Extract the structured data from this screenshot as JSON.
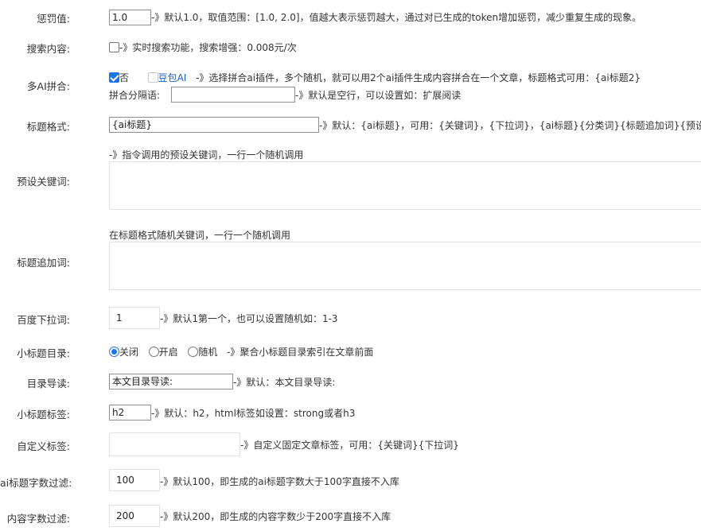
{
  "penalty": {
    "label": "惩罚值:",
    "value": "1.0",
    "hint": "-》默认1.0，取值范围：[1.0, 2.0]，值越大表示惩罚越大，通过对已生成的token增加惩罚，减少重复生成的现象。"
  },
  "search": {
    "label": "搜索内容:",
    "checked": false,
    "hint": "-》实时搜索功能，搜索增强：0.008元/次"
  },
  "multi_ai": {
    "label": "多AI拼合:",
    "option_no": "否",
    "option_no_checked": true,
    "option_doubao": "豆包AI",
    "option_doubao_checked": false,
    "hint": "-》选择拼合ai插件，多个随机，就可以用2个ai插件生成内容拼合在一个文章，标题格式可用：{ai标题2}",
    "separator_label": "拼合分隔语:",
    "separator_value": "",
    "separator_hint": "-》默认是空行，可以设置如：扩展阅读"
  },
  "title_format": {
    "label": "标题格式:",
    "value": "{ai标题}",
    "hint": "-》默认：{ai标题}，可用：{关键词}，{下拉词}，{ai标题}{分类词}{标题追加词}{预设关"
  },
  "preset_keywords": {
    "label": "预设关键词:",
    "hint": "-》指令调用的预设关键词，一行一个随机调用",
    "value": ""
  },
  "title_append": {
    "label": "标题追加词:",
    "hint": "在标题格式随机关键词，一行一个随机调用",
    "value": ""
  },
  "baidu_dropdown": {
    "label": "百度下拉词:",
    "value": "1",
    "hint": "-》默认1第一个，也可以设置随机如：1-3"
  },
  "subtitle_toc": {
    "label": "小标题目录:",
    "options": [
      "关闭",
      "开启",
      "随机"
    ],
    "selected": "关闭",
    "hint": "-》聚合小标题目录索引在文章前面"
  },
  "toc_intro": {
    "label": "目录导读:",
    "value": "本文目录导读:",
    "hint": "-》默认：本文目录导读:"
  },
  "subtitle_tag": {
    "label": "小标题标签:",
    "value": "h2",
    "hint": "-》默认：h2，html标签如设置：strong或者h3"
  },
  "custom_tag": {
    "label": "自定义标签:",
    "value": "",
    "hint": "-》自定义固定文章标签，可用：{关键词}{下拉词}"
  },
  "ai_title_filter": {
    "label": "ai标题字数过滤:",
    "value": "100",
    "hint": "-》默认100，即生成的ai标题字数大于100字直接不入库"
  },
  "content_filter": {
    "label": "内容字数过滤:",
    "value": "200",
    "hint": "-》默认200，即生成的内容字数少于200字直接不入库"
  },
  "colors": {
    "checkbox_accent": "#1a73e8",
    "input_border": "#8f8f8f",
    "soft_border": "#e2e2e2",
    "text": "#333333"
  }
}
